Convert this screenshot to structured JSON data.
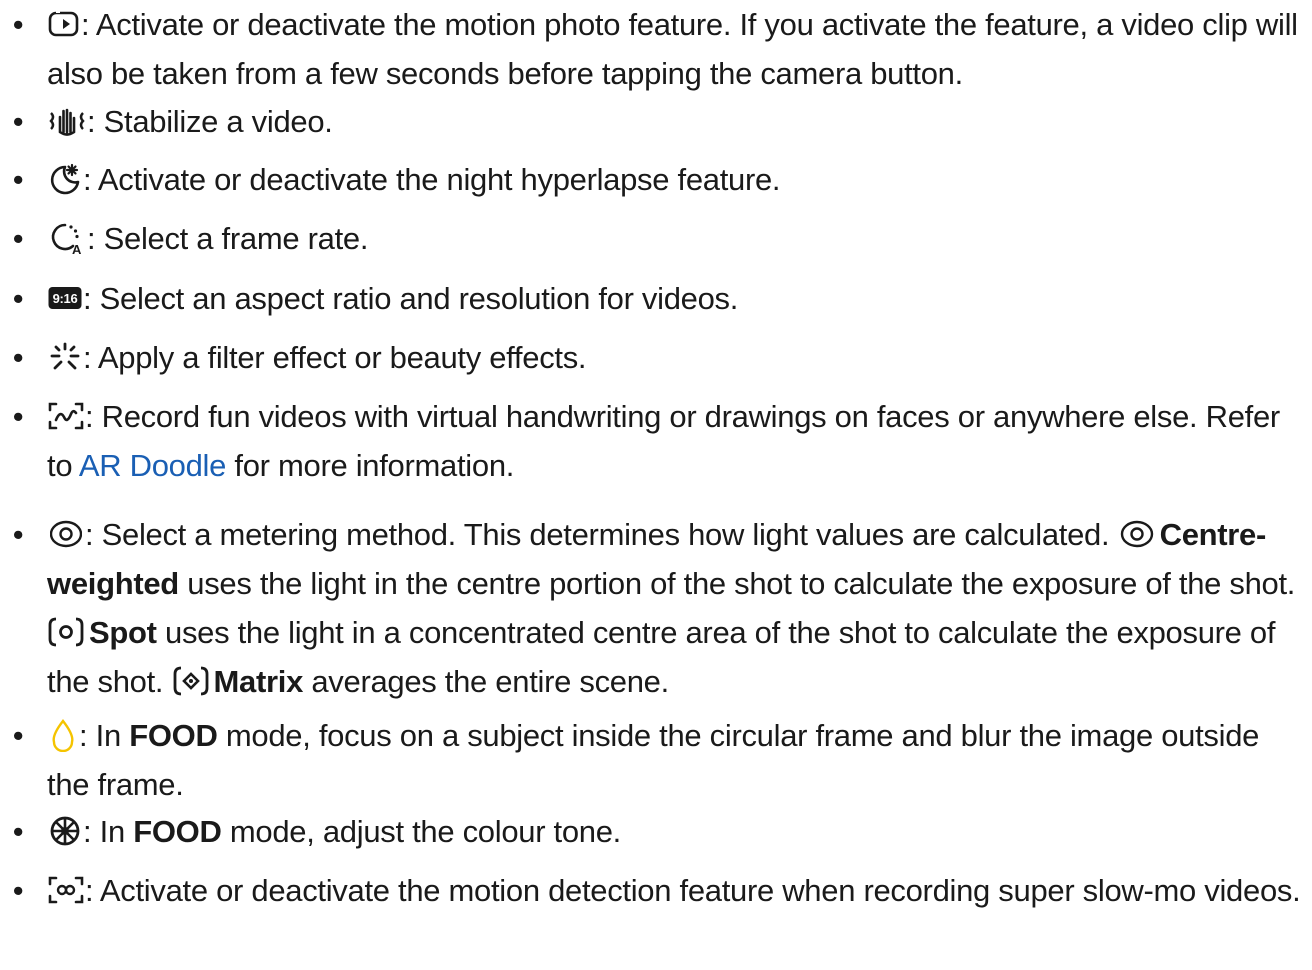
{
  "items": [
    {
      "icon": "motion-photo-icon",
      "parts": [
        {
          "text": ": Activate or deactivate the motion photo feature. If you activate the feature, a video clip will also be taken from a few seconds before tapping the camera button."
        }
      ]
    },
    {
      "icon": "stabilize-hand-icon",
      "parts": [
        {
          "text": ": Stabilize a video."
        }
      ]
    },
    {
      "icon": "night-hyperlapse-icon",
      "parts": [
        {
          "text": ": Activate or deactivate the night hyperlapse feature."
        }
      ]
    },
    {
      "icon": "frame-rate-icon",
      "parts": [
        {
          "text": ": Select a frame rate."
        }
      ]
    },
    {
      "icon": "aspect-ratio-icon",
      "icon_text": "9:16",
      "parts": [
        {
          "text": ": Select an aspect ratio and resolution for videos."
        }
      ]
    },
    {
      "icon": "filter-sparkle-icon",
      "parts": [
        {
          "text": ": Apply a filter effect or beauty effects."
        }
      ]
    },
    {
      "icon": "ar-doodle-icon",
      "parts": [
        {
          "text": ": Record fun videos with virtual handwriting or drawings on faces or anywhere else. Refer to "
        },
        {
          "text": "AR Doodle",
          "link": true
        },
        {
          "text": " for more information."
        }
      ]
    },
    {
      "icon": "metering-icon",
      "parts": [
        {
          "text": ": Select a metering method. This determines how light values are calculated. "
        },
        {
          "icon": "centre-weighted-icon"
        },
        {
          "text": "Centre-weighted",
          "bold": true
        },
        {
          "text": " uses the light in the centre portion of the shot to calculate the exposure of the shot. "
        },
        {
          "icon": "spot-metering-icon"
        },
        {
          "text": "Spot",
          "bold": true
        },
        {
          "text": " uses the light in a concentrated centre area of the shot to calculate the exposure of the shot. "
        },
        {
          "icon": "matrix-metering-icon"
        },
        {
          "text": "Matrix",
          "bold": true
        },
        {
          "text": " averages the entire scene."
        }
      ]
    },
    {
      "icon": "food-focus-icon",
      "parts": [
        {
          "text": ": In "
        },
        {
          "text": "FOOD",
          "bold": true
        },
        {
          "text": " mode, focus on a subject inside the circular frame and blur the image outside the frame."
        }
      ]
    },
    {
      "icon": "colour-tone-icon",
      "parts": [
        {
          "text": ": In "
        },
        {
          "text": "FOOD",
          "bold": true
        },
        {
          "text": " mode, adjust the colour tone."
        }
      ]
    },
    {
      "icon": "motion-detection-icon",
      "parts": [
        {
          "text": ": Activate or deactivate the motion detection feature when recording super slow-mo videos."
        }
      ]
    }
  ],
  "bullet_char": "•",
  "colors": {
    "text": "#1a1a1a",
    "link": "#1a5fb4",
    "food_icon": "#f5c400"
  }
}
